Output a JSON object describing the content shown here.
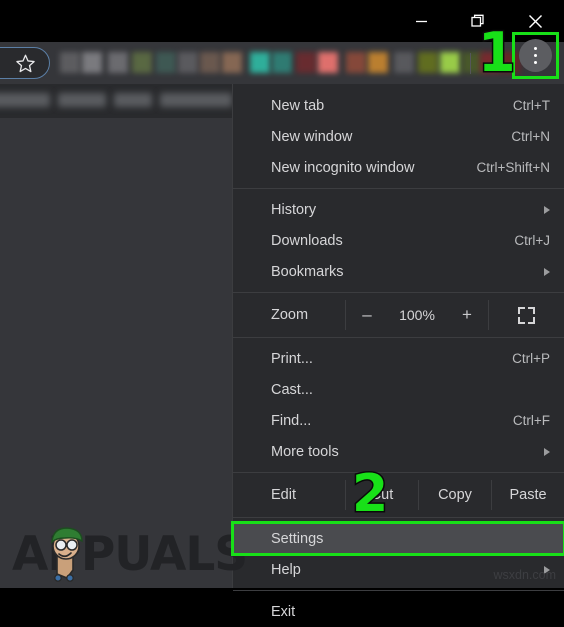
{
  "window": {
    "controls": [
      {
        "name": "minimize",
        "glyph": "minimize-icon"
      },
      {
        "name": "maximize",
        "glyph": "restore-icon"
      },
      {
        "name": "close",
        "glyph": "close-icon"
      }
    ]
  },
  "toolbar": {
    "bookmark_star": "star-icon",
    "menu_button": "three-dot-menu-icon",
    "extension_colors": [
      "#5f5f62",
      "#7e7e82",
      "#6e6e72",
      "#5b6b43",
      "#3f5a55",
      "#5c5c60",
      "#6d5a50",
      "#8a6a55",
      "#2fb5a0",
      "#2f7f76",
      "#6b2b2f",
      "#e8736f",
      "#8a4a3a",
      "#c2832f",
      "#5a5b5f",
      "#63701f",
      "#9ed349",
      "#4a5a2a",
      "#7a2a2e",
      "#6a2326"
    ]
  },
  "menu": {
    "groups": [
      {
        "type": "items",
        "items": [
          {
            "label": "New tab",
            "accel": "Ctrl+T",
            "arrow": false
          },
          {
            "label": "New window",
            "accel": "Ctrl+N",
            "arrow": false
          },
          {
            "label": "New incognito window",
            "accel": "Ctrl+Shift+N",
            "arrow": false
          }
        ]
      },
      {
        "type": "items",
        "items": [
          {
            "label": "History",
            "accel": "",
            "arrow": true
          },
          {
            "label": "Downloads",
            "accel": "Ctrl+J",
            "arrow": false
          },
          {
            "label": "Bookmarks",
            "accel": "",
            "arrow": true
          }
        ]
      },
      {
        "type": "zoom",
        "label": "Zoom",
        "minus": "–",
        "percent": "100%",
        "plus": "+",
        "fullscreen_icon": "fullscreen-icon"
      },
      {
        "type": "items",
        "items": [
          {
            "label": "Print...",
            "accel": "Ctrl+P",
            "arrow": false
          },
          {
            "label": "Cast...",
            "accel": "",
            "arrow": false
          },
          {
            "label": "Find...",
            "accel": "Ctrl+F",
            "arrow": false
          },
          {
            "label": "More tools",
            "accel": "",
            "arrow": true
          }
        ]
      },
      {
        "type": "edit",
        "label": "Edit",
        "cut": "Cut",
        "copy": "Copy",
        "paste": "Paste"
      },
      {
        "type": "items",
        "items": [
          {
            "label": "Settings",
            "accel": "",
            "arrow": false,
            "highlighted": true
          },
          {
            "label": "Help",
            "accel": "",
            "arrow": true
          }
        ]
      },
      {
        "type": "items",
        "items": [
          {
            "label": "Exit",
            "accel": "",
            "arrow": false
          }
        ]
      }
    ]
  },
  "annotations": {
    "step_1": "1",
    "step_2": "2",
    "highlight_color": "#18e018"
  },
  "watermarks": {
    "brand": "APPUALS",
    "site": "wsxdn.com"
  }
}
